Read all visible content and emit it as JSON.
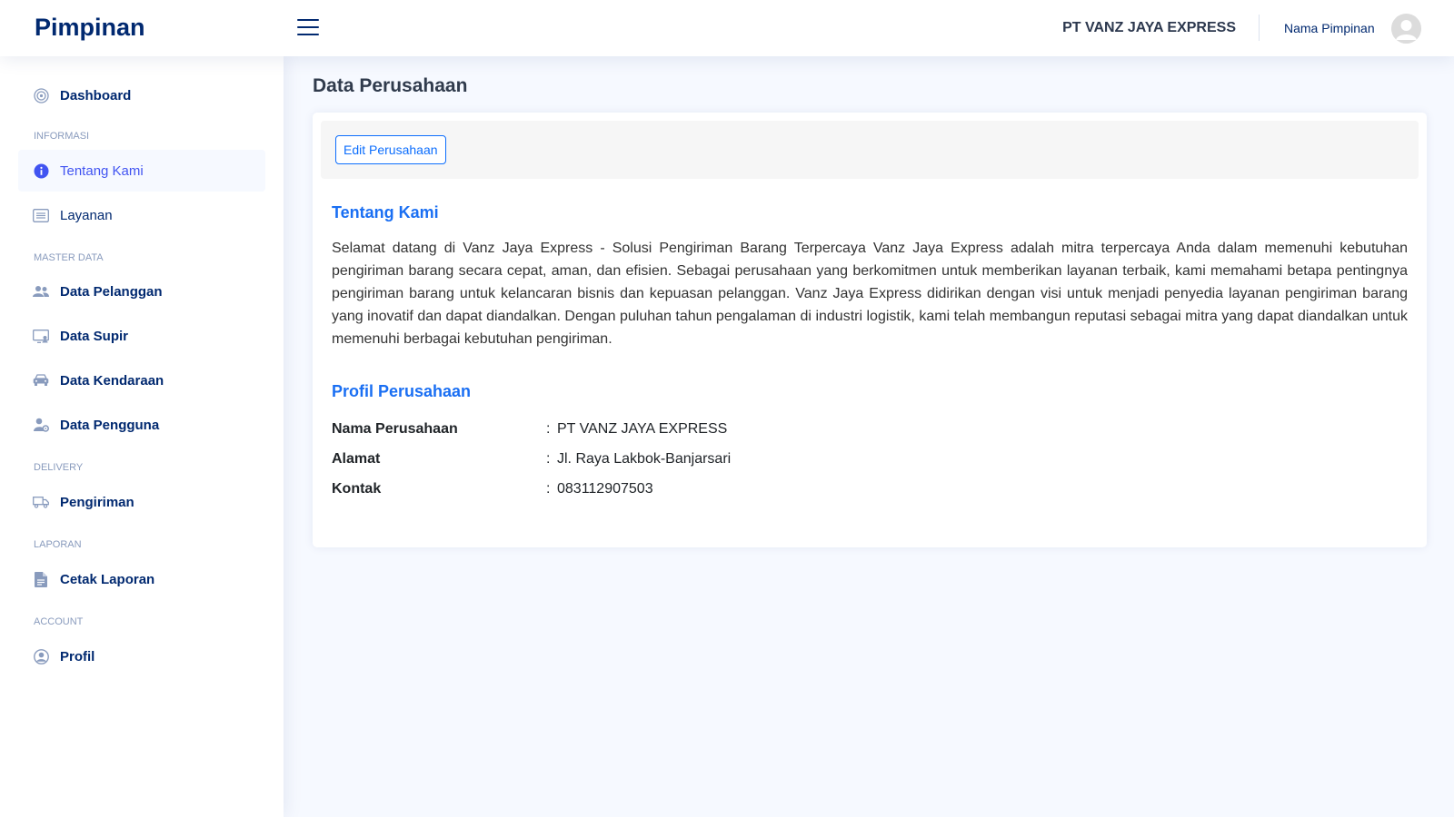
{
  "header": {
    "logo": "Pimpinan",
    "company": "PT VANZ JAYA EXPRESS",
    "user_name": "Nama Pimpinan"
  },
  "sidebar": {
    "dashboard": "Dashboard",
    "headings": [
      "INFORMASI",
      "MASTER DATA",
      "DELIVERY",
      "LAPORAN",
      "ACCOUNT"
    ],
    "items": {
      "tentang_kami": "Tentang Kami",
      "layanan": "Layanan",
      "data_pelanggan": "Data Pelanggan",
      "data_supir": "Data Supir",
      "data_kendaraan": "Data Kendaraan",
      "data_pengguna": "Data Pengguna",
      "pengiriman": "Pengiriman",
      "cetak_laporan": "Cetak Laporan",
      "profil": "Profil"
    },
    "active": "Tentang Kami"
  },
  "main": {
    "page_title": "Data Perusahaan",
    "edit_button": "Edit Perusahaan",
    "about_title": "Tentang Kami",
    "about_text": "Selamat datang di Vanz Jaya Express - Solusi Pengiriman Barang Terpercaya Vanz Jaya Express adalah mitra terpercaya Anda dalam memenuhi kebutuhan pengiriman barang secara cepat, aman, dan efisien. Sebagai perusahaan yang berkomitmen untuk memberikan layanan terbaik, kami memahami betapa pentingnya pengiriman barang untuk kelancaran bisnis dan kepuasan pelanggan. Vanz Jaya Express didirikan dengan visi untuk menjadi penyedia layanan pengiriman barang yang inovatif dan dapat diandalkan. Dengan puluhan tahun pengalaman di industri logistik, kami telah membangun reputasi sebagai mitra yang dapat diandalkan untuk memenuhi berbagai kebutuhan pengiriman.",
    "profile_title": "Profil Perusahaan",
    "profile": [
      {
        "label": "Nama Perusahaan",
        "sep": ":",
        "value": "PT VANZ JAYA EXPRESS"
      },
      {
        "label": "Alamat",
        "sep": ":",
        "value": "Jl. Raya Lakbok-Banjarsari"
      },
      {
        "label": "Kontak",
        "sep": ":",
        "value": "083112907503"
      }
    ]
  },
  "colors": {
    "primary": "#012970",
    "accent": "#4154f1",
    "link_blue": "#1a6ff3",
    "background": "#f6f9ff"
  }
}
